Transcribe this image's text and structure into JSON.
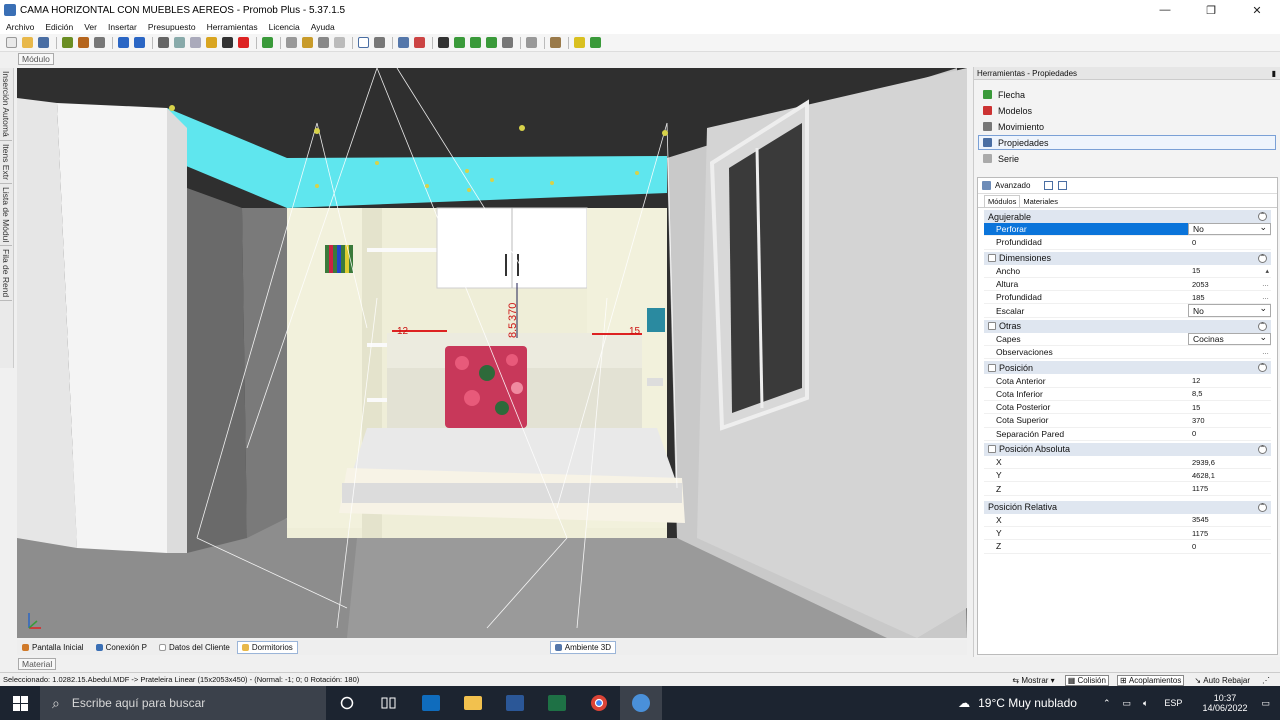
{
  "window": {
    "title": "CAMA HORIZONTAL CON MUEBLES AEREOS - Promob Plus - 5.37.1.5",
    "minimize": "—",
    "maximize": "❐",
    "close": "✕"
  },
  "menu": [
    "Archivo",
    "Edición",
    "Ver",
    "Insertar",
    "Presupuesto",
    "Herramientas",
    "Licencia",
    "Ayuda"
  ],
  "left_tabs": [
    "Inserción Automá",
    "Itens Extr",
    "Lista de Módul",
    "Fila de Rend"
  ],
  "modulo_tab": "Módulo",
  "material_tab": "Material",
  "viewport": {
    "dim_vertical": "8.5",
    "dim_vertical2": "370",
    "dim_left": "12",
    "dim_right": "15"
  },
  "dock_tabs": [
    {
      "label": "Pantalla Inicial",
      "color": "#d07a2a"
    },
    {
      "label": "Conexión P",
      "color": "#3a6fb5"
    },
    {
      "label": "Datos del Cliente",
      "color": "#ffffff"
    },
    {
      "label": "Dormitorios",
      "color": "#e8b84a"
    }
  ],
  "ambiente_tab": "Ambiente 3D",
  "panel": {
    "title": "Herramientas - Propiedades",
    "tools": [
      "Flecha",
      "Modelos",
      "Movimiento",
      "Propiedades",
      "Serie"
    ],
    "avanzado": "Avanzado",
    "subtabs": [
      "Módulos",
      "Materiales"
    ]
  },
  "groups": {
    "agujerable": {
      "title": "Agujerable",
      "rows": [
        {
          "label": "Perforar",
          "value": "No"
        },
        {
          "label": "Profundidad",
          "value": "0"
        }
      ]
    },
    "dimensiones": {
      "title": "Dimensiones",
      "rows": [
        {
          "label": "Ancho",
          "value": "15"
        },
        {
          "label": "Altura",
          "value": "2053"
        },
        {
          "label": "Profundidad",
          "value": "185"
        },
        {
          "label": "Escalar",
          "value": "No"
        }
      ]
    },
    "otras": {
      "title": "Otras",
      "rows": [
        {
          "label": "Capes",
          "value": "Cocinas"
        },
        {
          "label": "Observaciones",
          "value": ""
        }
      ]
    },
    "posicion": {
      "title": "Posición",
      "rows": [
        {
          "label": "Cota Anterior",
          "value": "12"
        },
        {
          "label": "Cota Inferior",
          "value": "8,5"
        },
        {
          "label": "Cota Posterior",
          "value": "15"
        },
        {
          "label": "Cota Superior",
          "value": "370"
        },
        {
          "label": "Separación Pared",
          "value": "0"
        }
      ]
    },
    "absoluta": {
      "title": "Posición Absoluta",
      "rows": [
        {
          "label": "X",
          "value": "2939,6"
        },
        {
          "label": "Y",
          "value": "4628,1"
        },
        {
          "label": "Z",
          "value": "1175"
        }
      ]
    },
    "relativa": {
      "title": "Posición Relativa",
      "rows": [
        {
          "label": "X",
          "value": "3545"
        },
        {
          "label": "Y",
          "value": "1175"
        },
        {
          "label": "Z",
          "value": "0"
        }
      ]
    }
  },
  "status": {
    "text": "Seleccionado: 1.0282.15.Abedul.MDF -> Prateleira Linear (15x2053x450) - (Normal: -1; 0; 0 Rotación: 180)",
    "mostrar": "Mostrar",
    "colision": "Colisión",
    "acoplamientos": "Acoplamientos",
    "auto_rebajar": "Auto Rebajar"
  },
  "taskbar": {
    "search_placeholder": "Escribe aquí para buscar",
    "weather": "19°C  Muy nublado",
    "lang": "ESP",
    "time": "10:37",
    "date": "14/06/2022"
  }
}
